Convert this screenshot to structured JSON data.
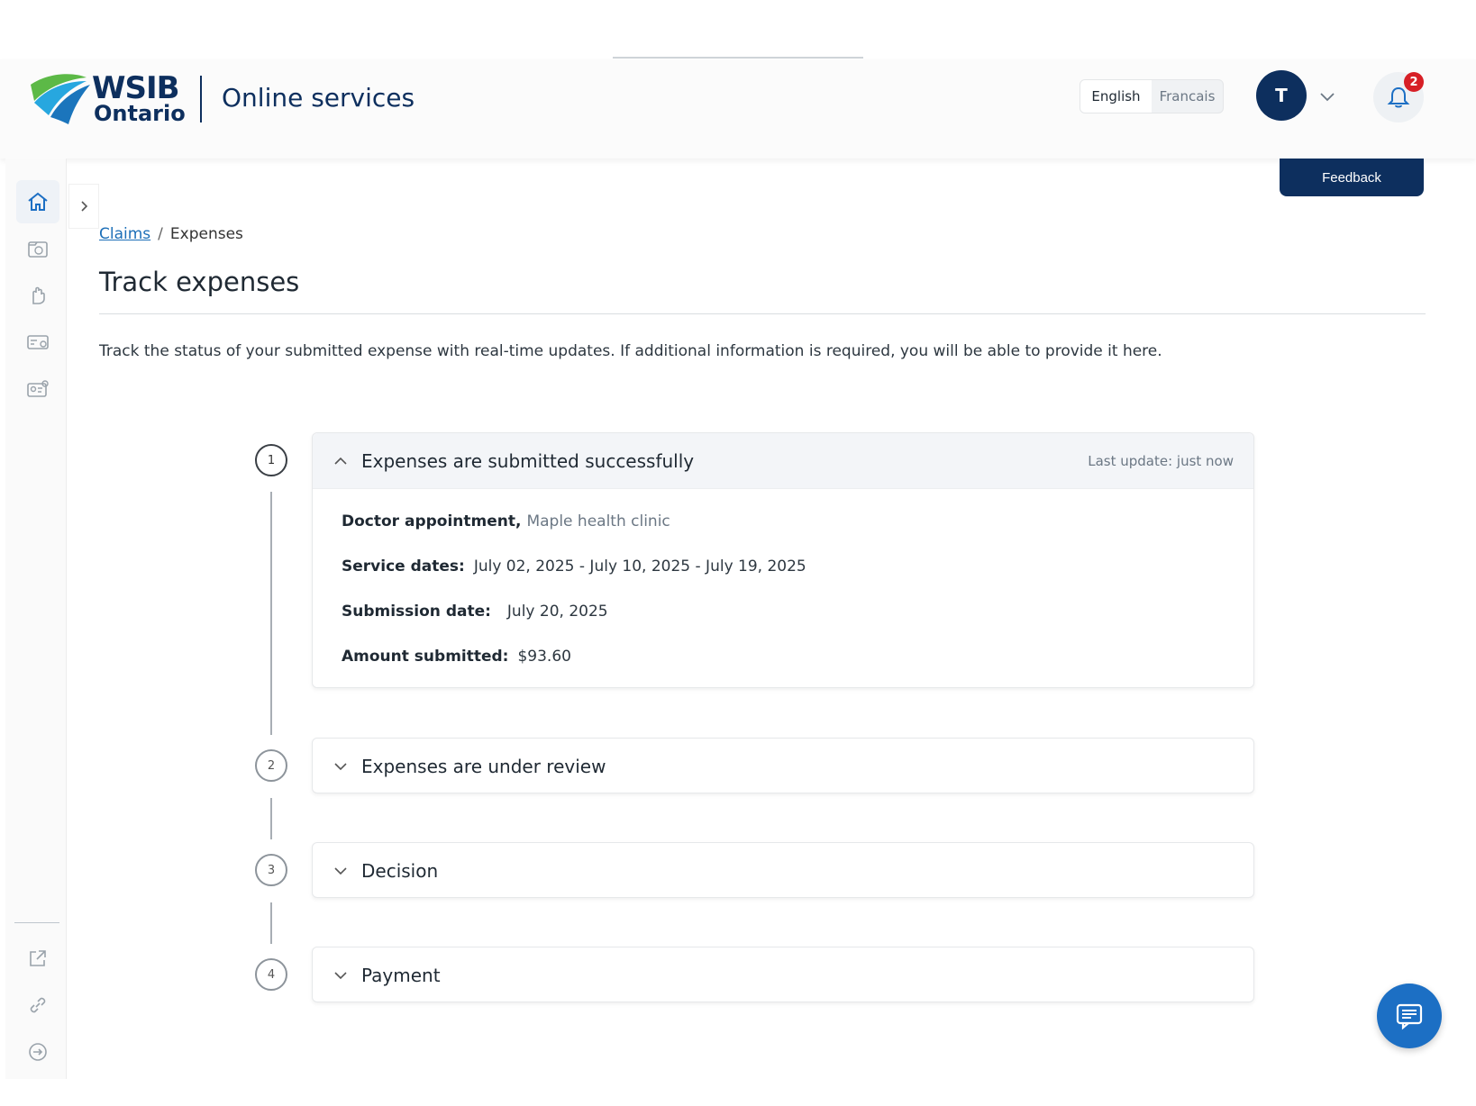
{
  "header": {
    "logo_line1": "WSIB",
    "logo_line2": "Ontario",
    "app_title": "Online services",
    "lang_english": "English",
    "lang_french": "Francais",
    "avatar_initial": "T",
    "notification_count": "2"
  },
  "feedback_label": "Feedback",
  "breadcrumb": {
    "parent": "Claims",
    "separator": "/",
    "current": "Expenses"
  },
  "page": {
    "title": "Track expenses",
    "intro": "Track the status of your submitted expense with real-time updates. If additional information is required, you will be able to provide it here."
  },
  "steps": [
    {
      "number": "1",
      "title": "Expenses are submitted successfully",
      "last_update": "Last update: just now",
      "details": {
        "appointment_label": "Doctor appointment,",
        "appointment_provider": "Maple health clinic",
        "service_dates_label": "Service dates:",
        "service_dates_value": "July 02, 2025 - July 10, 2025 - July 19, 2025",
        "submission_label": "Submission date:",
        "submission_value": "July 20, 2025",
        "amount_label": "Amount submitted:",
        "amount_value": "$93.60"
      }
    },
    {
      "number": "2",
      "title": "Expenses are under review"
    },
    {
      "number": "3",
      "title": "Decision"
    },
    {
      "number": "4",
      "title": "Payment"
    }
  ],
  "icons": {
    "sidebar": [
      "home-icon",
      "claims-folder-icon",
      "hand-icon",
      "payments-card-icon",
      "profile-card-icon",
      "external-link-icon",
      "link-icon",
      "logout-icon"
    ],
    "header": [
      "chevron-down-icon",
      "bell-icon"
    ],
    "fab": "chat-icon"
  },
  "colors": {
    "brand_navy": "#0d2f5e",
    "link_blue": "#1c6fb8",
    "fab_blue": "#1c6fc4",
    "badge_red": "#d71f26"
  }
}
